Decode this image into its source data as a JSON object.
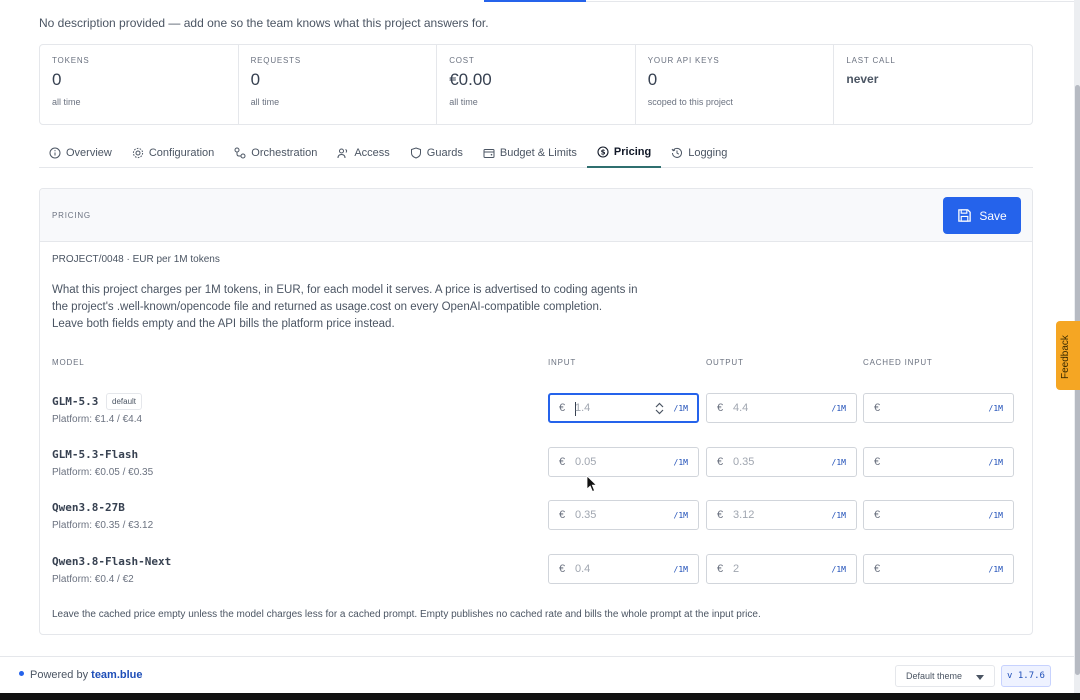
{
  "description": "No description provided — add one so the team knows what this project answers for.",
  "stats": [
    {
      "label": "TOKENS",
      "value": "0",
      "sub": "all time"
    },
    {
      "label": "REQUESTS",
      "value": "0",
      "sub": "all time"
    },
    {
      "label": "COST",
      "value": "€0.00",
      "sub": "all time"
    },
    {
      "label": "YOUR API KEYS",
      "value": "0",
      "sub": "scoped to this project"
    },
    {
      "label": "LAST CALL",
      "value": "never",
      "sub": ""
    }
  ],
  "tabs": [
    {
      "label": "Overview",
      "icon": "info-icon"
    },
    {
      "label": "Configuration",
      "icon": "gear-icon"
    },
    {
      "label": "Orchestration",
      "icon": "workflow-icon"
    },
    {
      "label": "Access",
      "icon": "users-icon"
    },
    {
      "label": "Guards",
      "icon": "shield-icon"
    },
    {
      "label": "Budget & Limits",
      "icon": "wallet-icon"
    },
    {
      "label": "Pricing",
      "icon": "dollar-circle-icon",
      "active": true
    },
    {
      "label": "Logging",
      "icon": "history-icon"
    }
  ],
  "pricing": {
    "title": "PRICING",
    "save_label": "Save",
    "project_line": "PROJECT/0048 · EUR per 1M tokens",
    "explain_lines": [
      "What this project charges per 1M tokens, in EUR, for each model it serves. A price is advertised to coding agents in",
      "the project's .well-known/opencode file and returned as usage.cost on every OpenAI-compatible completion.",
      "Leave both fields empty and the API bills the platform price instead."
    ],
    "columns": {
      "model": "MODEL",
      "input": "INPUT",
      "output": "OUTPUT",
      "cached": "CACHED INPUT"
    },
    "currency": "€",
    "unit": "/1M",
    "rows": [
      {
        "model": "GLM-5.3",
        "badge": "default",
        "platform": "Platform: €1.4 / €4.4",
        "input": "1.4",
        "output": "4.4",
        "cached": ""
      },
      {
        "model": "GLM-5.3-Flash",
        "badge": "",
        "platform": "Platform: €0.05 / €0.35",
        "input": "0.05",
        "output": "0.35",
        "cached": ""
      },
      {
        "model": "Qwen3.8-27B",
        "badge": "",
        "platform": "Platform: €0.35 / €3.12",
        "input": "0.35",
        "output": "3.12",
        "cached": ""
      },
      {
        "model": "Qwen3.8-Flash-Next",
        "badge": "",
        "platform": "Platform: €0.4 / €2",
        "input": "0.4",
        "output": "2",
        "cached": ""
      }
    ],
    "footnote": "Leave the cached price empty unless the model charges less for a cached prompt. Empty publishes no cached rate and bills the whole prompt at the input price."
  },
  "footer": {
    "powered_prefix": "Powered by",
    "brand": "team.blue",
    "theme": "Default theme",
    "version": "v 1.7.6"
  },
  "feedback_label": "Feedback",
  "colors": {
    "accent": "#2563eb",
    "active_tab": "#2f6f6f",
    "feedback": "#f5a623"
  }
}
